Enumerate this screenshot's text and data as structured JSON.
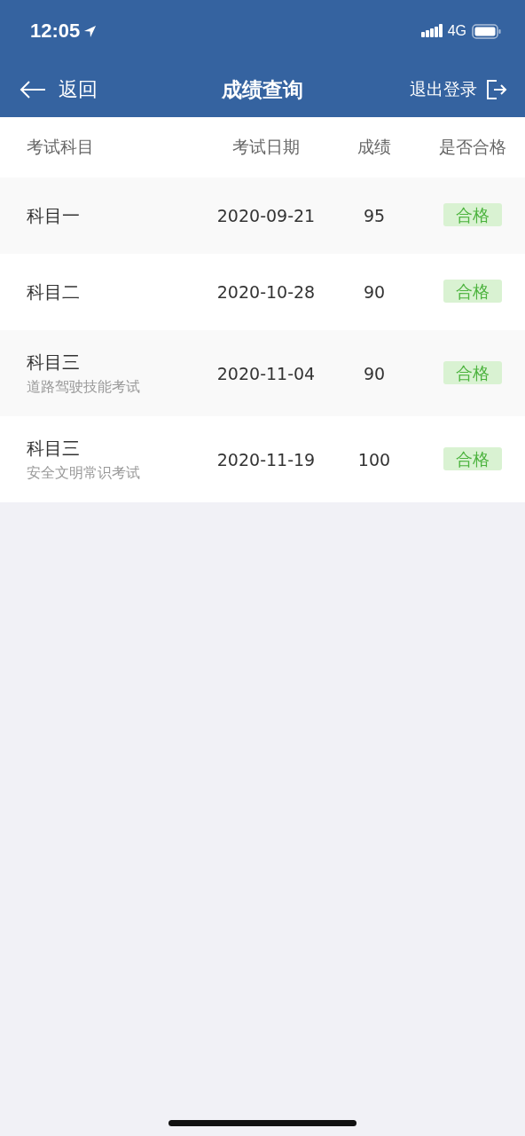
{
  "status_bar": {
    "time": "12:05",
    "network": "4G"
  },
  "nav_bar": {
    "back_label": "返回",
    "title": "成绩查询",
    "logout_label": "退出登录"
  },
  "table": {
    "columns": [
      "考试科目",
      "考试日期",
      "成绩",
      "是否合格"
    ],
    "rows": [
      {
        "subject": "科目一",
        "date": "2020-09-21",
        "score": "95",
        "result": "合格",
        "passed": true
      },
      {
        "subject": "科目二",
        "date": "2020-10-28",
        "score": "90",
        "result": "合格",
        "passed": true
      },
      {
        "subject": "科目三",
        "subtitle": "道路驾驶技能考试",
        "date": "2020-11-04",
        "score": "90",
        "result": "合格",
        "passed": true
      },
      {
        "subject": "科目三",
        "subtitle": "安全文明常识考试",
        "date": "2020-11-19",
        "score": "100",
        "result": "合格",
        "passed": true
      }
    ]
  }
}
